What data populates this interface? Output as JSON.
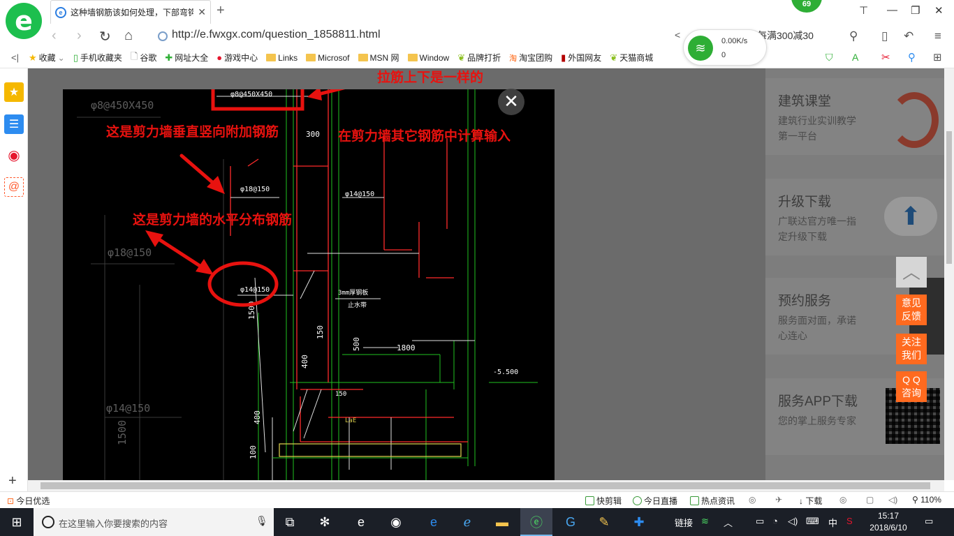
{
  "browser": {
    "logo_glyph": "e",
    "tab": {
      "title": "这种墙钢筋该如何处理，下部弯钩",
      "favicon": "e",
      "close": "✕"
    },
    "new_tab": "+",
    "badge": "69",
    "window_controls": {
      "skin": "⊤",
      "minimize": "—",
      "restore": "❐",
      "close": "✕"
    },
    "nav": {
      "back": "‹",
      "forward": "›",
      "refresh": "↻",
      "home": "⌂"
    },
    "url": "http://e.fwxgx.com/question_1858811.html",
    "promo_text": "选每满300减30",
    "network": {
      "speed": "0.00K/s",
      "count": "0"
    }
  },
  "bookmarks": [
    {
      "label": "收藏",
      "icon": "star-icon",
      "glyph": "★"
    },
    {
      "label": "手机收藏夹",
      "icon": "phone-icon",
      "glyph": "▯"
    },
    {
      "label": "谷歌",
      "icon": "page-icon",
      "glyph": "🗋"
    },
    {
      "label": "网址大全",
      "icon": "globe-icon",
      "glyph": "✚"
    },
    {
      "label": "游戏中心",
      "icon": "game-icon",
      "glyph": "●"
    },
    {
      "label": "Links",
      "icon": "folder-icon",
      "glyph": ""
    },
    {
      "label": "Microsof",
      "icon": "folder-icon",
      "glyph": ""
    },
    {
      "label": "MSN 网",
      "icon": "folder-icon",
      "glyph": ""
    },
    {
      "label": "Window",
      "icon": "folder-icon",
      "glyph": ""
    },
    {
      "label": "品牌打折",
      "icon": "leaf-icon",
      "glyph": "❦"
    },
    {
      "label": "淘宝团购",
      "icon": "taobao-icon",
      "glyph": "淘"
    },
    {
      "label": "外国网友",
      "icon": "flag-icon",
      "glyph": "▮"
    },
    {
      "label": "天猫商城",
      "icon": "leaf-icon",
      "glyph": "❦"
    }
  ],
  "sidebar": {
    "items": [
      {
        "name": "favorites",
        "glyph": "★",
        "color": "#f5b800"
      },
      {
        "name": "reader",
        "glyph": "☰",
        "color": "#2d8cf0"
      },
      {
        "name": "weibo",
        "glyph": "◉",
        "color": "#e6162d"
      },
      {
        "name": "mail",
        "glyph": "@",
        "color": "#ff5a2e"
      }
    ],
    "add": "+"
  },
  "drawing": {
    "labels": {
      "top_spec": "φ8@450X450",
      "top_spec_bg": "φ8@450X450",
      "bar_18": "φ18@150",
      "bar_18_bg": "φ18@150",
      "bar_14": "φ14@150",
      "bar_14_circled": "φ14@150",
      "bar_14_bg": "φ14@150",
      "dim_300": "300",
      "dim_1800": "1800",
      "dim_1500": "1500",
      "dim_1500_bg": "1500",
      "dim_400": "400",
      "dim_500": "500",
      "dim_100": "100",
      "dim_150": "150",
      "elev": "-5.500",
      "note_3mm": "3mm厚钢板",
      "note_stop": "止水带",
      "lae": "LaE",
      "l150": "150"
    },
    "annotations": {
      "tie_bars": "拉筋上下是一样的",
      "vertical_added": "这是剪力墙垂直竖向附加钢筋",
      "calc_other": "在剪力墙其它钢筋中计算输入",
      "horizontal": "这是剪力墙的水平分布钢筋"
    },
    "close": "✕"
  },
  "side_services": [
    {
      "title": "建筑课堂",
      "desc": "建筑行业实训教学第一平台"
    },
    {
      "title": "升级下载",
      "desc": "广联达官方唯一指定升级下载"
    },
    {
      "title": "预约服务",
      "desc": "服务面对面，承诺心连心"
    },
    {
      "title": "服务APP下载",
      "desc": "您的掌上服务专家"
    }
  ],
  "float_buttons": {
    "top": "︿",
    "feedback": [
      "意见",
      "反馈"
    ],
    "follow": [
      "关注",
      "我们"
    ],
    "qq": [
      "Q Q",
      "咨询"
    ]
  },
  "statusbar": {
    "left": "今日优选",
    "items": [
      "快剪辑",
      "今日直播",
      "热点资讯"
    ],
    "download": "下载",
    "zoom": "110%"
  },
  "taskbar": {
    "search_placeholder": "在这里输入你要搜索的内容",
    "tray_link": "链接",
    "ime": "中",
    "time": "15:17",
    "date": "2018/6/10"
  },
  "colors": {
    "accent_red": "#e8120f",
    "brand_green": "#1dbf4e",
    "float_orange": "#ff6a1f"
  }
}
